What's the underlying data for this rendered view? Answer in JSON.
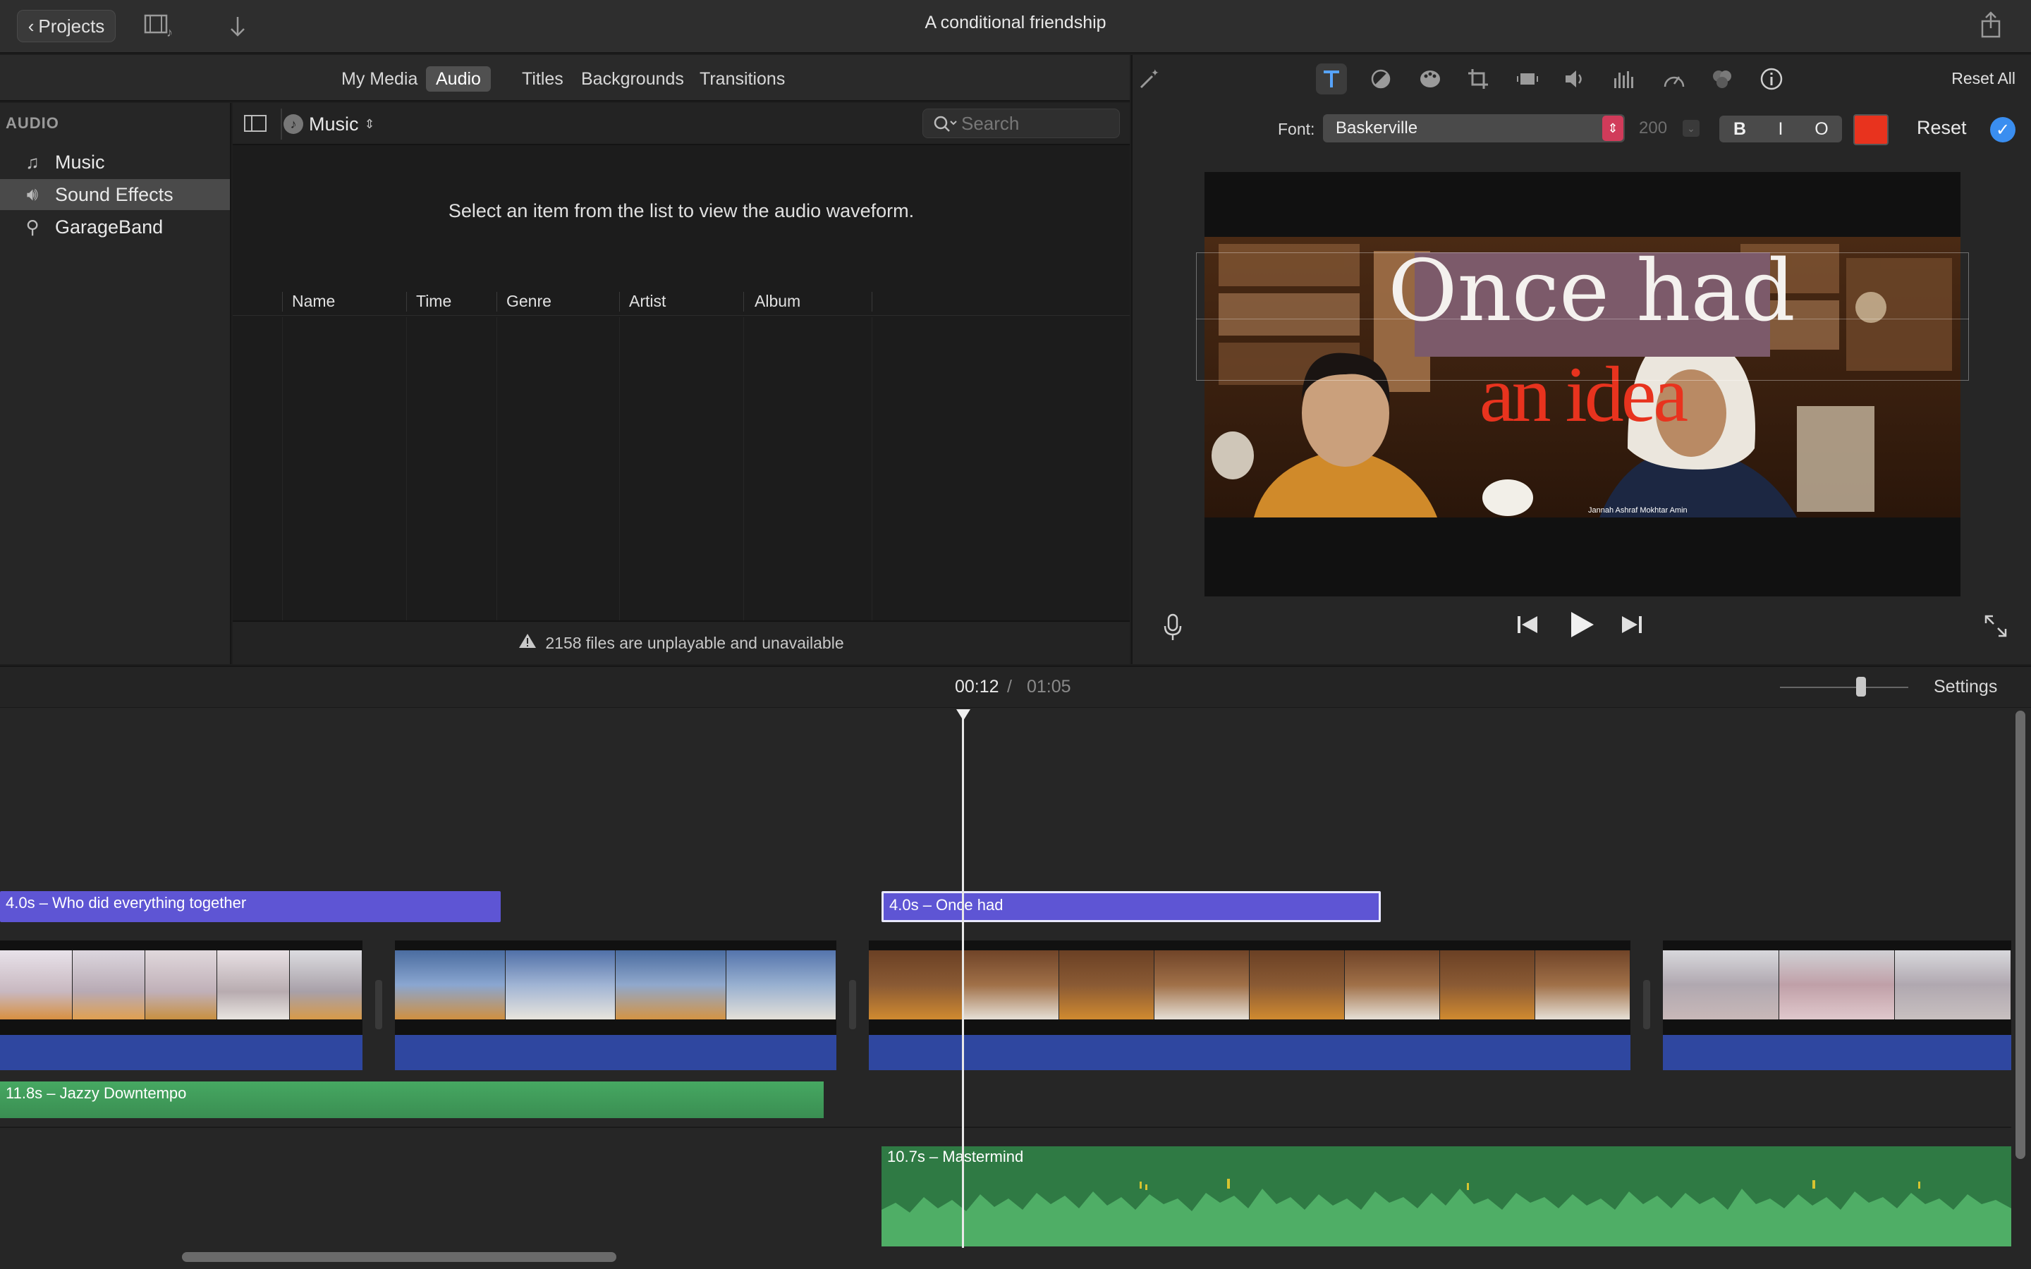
{
  "window": {
    "title": "A conditional friendship",
    "projects_label": "Projects"
  },
  "icons": {
    "back": "chevron-left-icon",
    "media_toggle": "film-music-icon",
    "import": "download-arrow-icon",
    "share": "share-icon"
  },
  "media_tabs": [
    "My Media",
    "Audio",
    "Titles",
    "Backgrounds",
    "Transitions"
  ],
  "active_media_tab": "Audio",
  "sidebar": {
    "heading": "AUDIO",
    "items": [
      {
        "label": "Music",
        "icon": "music-note-icon"
      },
      {
        "label": "Sound Effects",
        "icon": "speaker-icon"
      },
      {
        "label": "GarageBand",
        "icon": "guitar-icon"
      }
    ],
    "selected": "Sound Effects"
  },
  "audio_browser": {
    "source_label": "Music",
    "search_placeholder": "Search",
    "hint": "Select an item from the list to view the audio waveform.",
    "columns": [
      "Name",
      "Time",
      "Genre",
      "Artist",
      "Album"
    ],
    "footer": "2158 files are unplayable and unavailable"
  },
  "inspector": {
    "reset_all": "Reset All",
    "font_label": "Font:",
    "font_name": "Baskerville",
    "font_size": "200",
    "format_buttons": [
      "B",
      "I",
      "O"
    ],
    "text_color": "#e8331e",
    "reset_label": "Reset"
  },
  "viewer": {
    "title_line1": "Once had",
    "title_line2": "an idea",
    "caption": "Jannah Ashraf Mokhtar Amin"
  },
  "timeline": {
    "current_time": "00:12",
    "separator": "/",
    "total_time": "01:05",
    "settings_label": "Settings",
    "title_clips": [
      {
        "label": "4.0s – Who did everything together"
      },
      {
        "label": "4.0s – Once had"
      }
    ],
    "audio_clips": [
      {
        "label": "11.8s – Jazzy Downtempo"
      },
      {
        "label": "10.7s – Mastermind"
      }
    ]
  }
}
